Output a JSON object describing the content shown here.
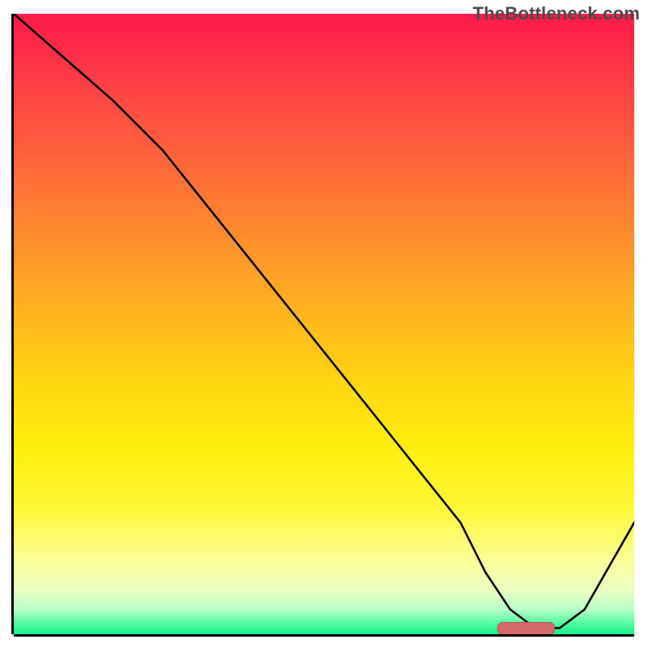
{
  "watermark": {
    "text": "TheBottleneck.com"
  },
  "chart_data": {
    "type": "line",
    "title": "",
    "xlabel": "",
    "ylabel": "",
    "xlim": [
      0,
      100
    ],
    "ylim": [
      0,
      100
    ],
    "x": [
      0,
      8,
      16,
      24,
      32,
      40,
      48,
      56,
      64,
      72,
      76,
      80,
      84,
      88,
      92,
      100
    ],
    "values": [
      100,
      93,
      86,
      78,
      68,
      58,
      48,
      38,
      28,
      18,
      10,
      4,
      1,
      1,
      4,
      18
    ],
    "marker": {
      "x_start": 78,
      "x_end": 87,
      "y": 1
    },
    "background_gradient_stops": [
      {
        "pos": 0,
        "color": "#ff1a4b"
      },
      {
        "pos": 50,
        "color": "#ffba1c"
      },
      {
        "pos": 80,
        "color": "#fff83a"
      },
      {
        "pos": 100,
        "color": "#17f08a"
      }
    ]
  }
}
